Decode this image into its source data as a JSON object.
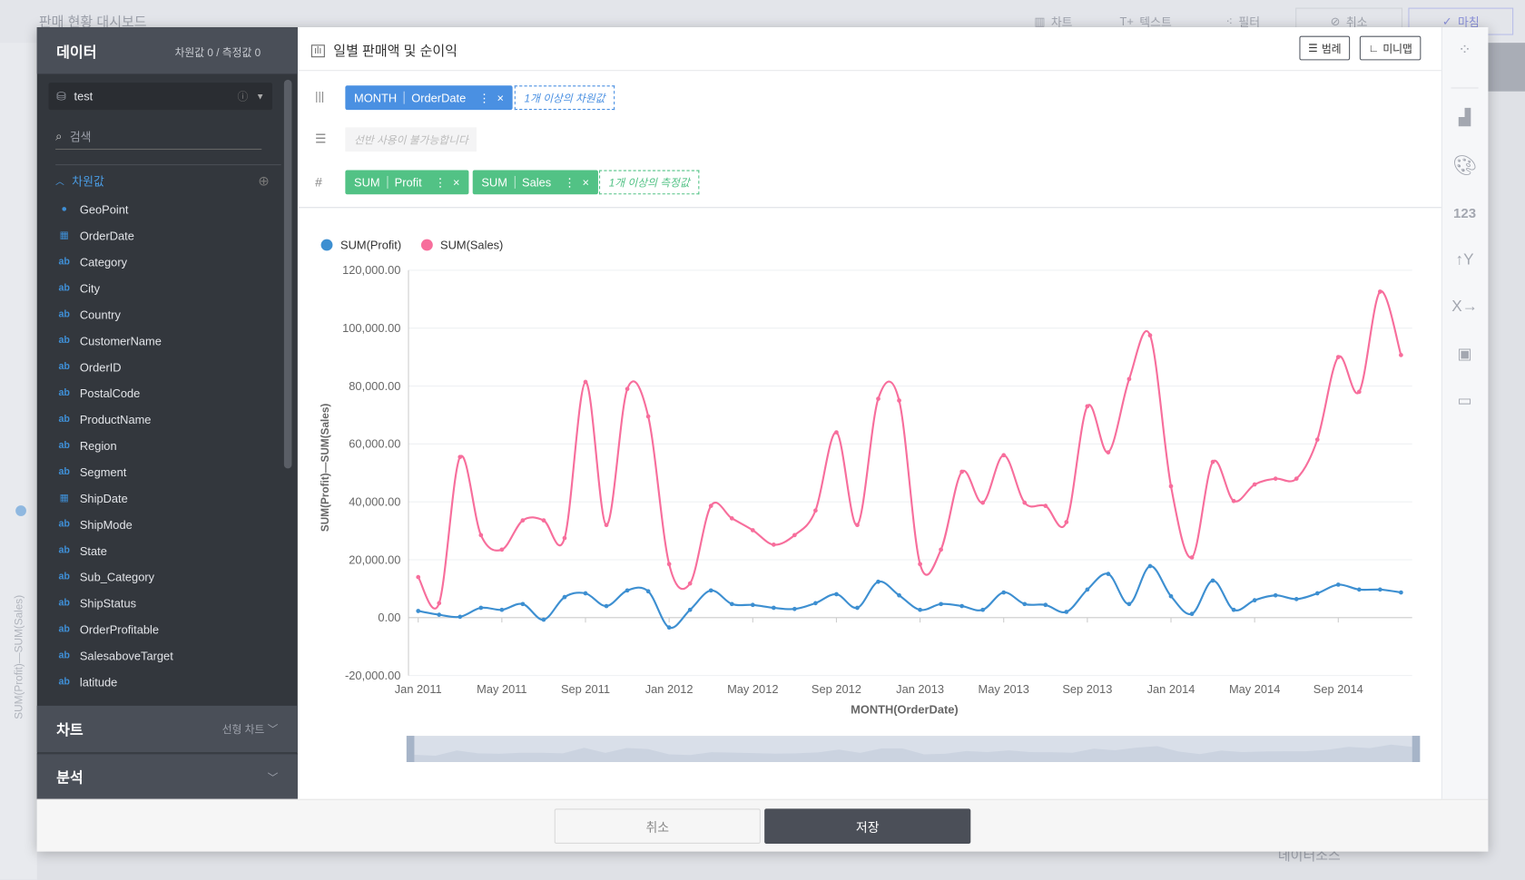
{
  "background": {
    "dashboard_title": "판매 현황 대시보드",
    "toolbar": [
      "차트",
      "텍스트",
      "필터",
      "취소",
      "마침"
    ],
    "datasource_label": "데이터소스",
    "axis_label": "SUM(Profit)—SUM(Sales)"
  },
  "data_panel": {
    "title": "데이터",
    "counts": "차원값 0 / 측정값 0",
    "datasource": "test",
    "search_placeholder": "검색",
    "dimension_header": "차원값",
    "fields": [
      {
        "name": "GeoPoint",
        "type": "geo"
      },
      {
        "name": "OrderDate",
        "type": "date"
      },
      {
        "name": "Category",
        "type": "ab"
      },
      {
        "name": "City",
        "type": "ab"
      },
      {
        "name": "Country",
        "type": "ab"
      },
      {
        "name": "CustomerName",
        "type": "ab"
      },
      {
        "name": "OrderID",
        "type": "ab"
      },
      {
        "name": "PostalCode",
        "type": "ab"
      },
      {
        "name": "ProductName",
        "type": "ab"
      },
      {
        "name": "Region",
        "type": "ab"
      },
      {
        "name": "Segment",
        "type": "ab"
      },
      {
        "name": "ShipDate",
        "type": "date"
      },
      {
        "name": "ShipMode",
        "type": "ab"
      },
      {
        "name": "State",
        "type": "ab"
      },
      {
        "name": "Sub_Category",
        "type": "ab"
      },
      {
        "name": "ShipStatus",
        "type": "ab"
      },
      {
        "name": "OrderProfitable",
        "type": "ab"
      },
      {
        "name": "SalesaboveTarget",
        "type": "ab"
      },
      {
        "name": "latitude",
        "type": "ab"
      }
    ],
    "chart_section": "차트",
    "chart_type": "선형 차트",
    "analysis_section": "분석"
  },
  "header": {
    "title": "일별 판매액 및 순이익",
    "legend_button": "범례",
    "minimap_button": "미니맵"
  },
  "shelves": {
    "columns": [
      {
        "agg": "MONTH",
        "field": "OrderDate"
      }
    ],
    "columns_placeholder": "1개 이상의 차원값",
    "rows_disabled": "선반 사용이 불가능합니다",
    "measures": [
      {
        "agg": "SUM",
        "field": "Profit"
      },
      {
        "agg": "SUM",
        "field": "Sales"
      }
    ],
    "measures_placeholder": "1개 이상의 측정값"
  },
  "colors": {
    "dimension": "#4a90e2",
    "measure": "#52c285",
    "profit": "#3d8fd1",
    "sales": "#f76e9c",
    "dark": "#4b4f58"
  },
  "footer": {
    "cancel": "취소",
    "save": "저장"
  },
  "right_toolbar": [
    "dots-icon",
    "bar-chart-icon",
    "palette-icon",
    "number-format-icon",
    "y-axis-icon",
    "x-axis-icon",
    "text-box-icon",
    "comment-icon"
  ],
  "chart_data": {
    "type": "line",
    "smooth": true,
    "xlabel": "MONTH(OrderDate)",
    "ylabel": "SUM(Profit)—SUM(Sales)",
    "ylim": [
      -20000,
      120000
    ],
    "yticks": [
      "120,000.00",
      "100,000.00",
      "80,000.00",
      "60,000.00",
      "40,000.00",
      "20,000.00",
      "0.00",
      "-20,000.00"
    ],
    "xticks": [
      "Jan 2011",
      "May 2011",
      "Sep 2011",
      "Jan 2012",
      "May 2012",
      "Sep 2012",
      "Jan 2013",
      "May 2013",
      "Sep 2013",
      "Jan 2014",
      "May 2014",
      "Sep 2014"
    ],
    "x_range": [
      "2011-01",
      "2014-12"
    ],
    "legend_position": "top-left",
    "grid": true,
    "minimap": true,
    "series": [
      {
        "name": "SUM(Profit)",
        "color": "#3d8fd1",
        "values": [
          2300,
          1000,
          300,
          3400,
          2700,
          4700,
          -700,
          7100,
          8400,
          4000,
          9400,
          9100,
          -3400,
          2700,
          9400,
          4700,
          4400,
          3400,
          3000,
          5000,
          8100,
          3400,
          12400,
          7700,
          2700,
          4700,
          4000,
          2700,
          8700,
          4700,
          4400,
          2000,
          9700,
          15100,
          4700,
          17800,
          7400,
          1300,
          12800,
          2700,
          6000,
          7700,
          6400,
          8400,
          11400,
          9700,
          9700,
          8700
        ]
      },
      {
        "name": "SUM(Sales)",
        "color": "#f76e9c",
        "values": [
          14000,
          5000,
          55500,
          28500,
          23500,
          33600,
          33600,
          27500,
          81400,
          32000,
          79000,
          69500,
          18500,
          11800,
          38600,
          34300,
          30200,
          25200,
          28500,
          37000,
          64000,
          32000,
          75600,
          75000,
          18500,
          23500,
          50400,
          39700,
          56100,
          39700,
          38600,
          33000,
          73000,
          57100,
          82400,
          97500,
          45400,
          20800,
          53800,
          40300,
          46000,
          48000,
          48000,
          61500,
          90000,
          78000,
          112600,
          90700
        ]
      }
    ]
  }
}
